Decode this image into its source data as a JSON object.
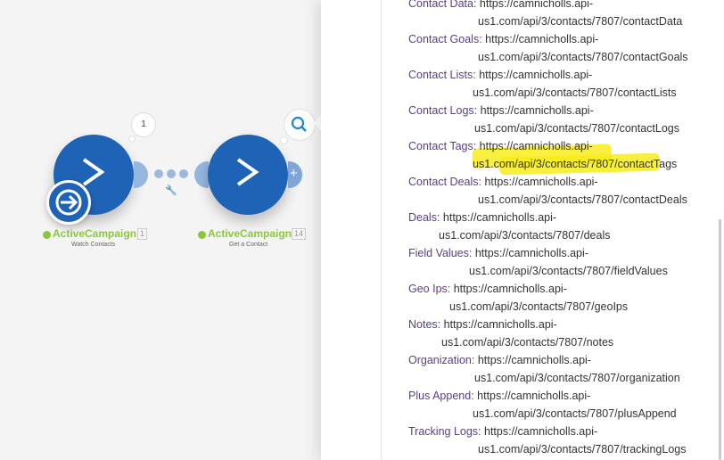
{
  "scenario": {
    "modules": [
      {
        "name": "ActiveCampaign",
        "subtitle": "Watch Contacts",
        "count": "1",
        "bubble": "1"
      },
      {
        "name": "ActiveCampaign",
        "subtitle": "Get a Contact",
        "count": "14"
      }
    ]
  },
  "panel": {
    "items": [
      {
        "key": "Contact Data:",
        "line1": "https://camnicholls.api-",
        "line2": "us1.com/api/3/contacts/7807/contactData"
      },
      {
        "key": "Contact Goals:",
        "line1": "https://camnicholls.api-",
        "line2": "us1.com/api/3/contacts/7807/contactGoals"
      },
      {
        "key": "Contact Lists:",
        "line1": "https://camnicholls.api-",
        "line2": "us1.com/api/3/contacts/7807/contactLists"
      },
      {
        "key": "Contact Logs:",
        "line1": "https://camnicholls.api-",
        "line2": "us1.com/api/3/contacts/7807/contactLogs"
      },
      {
        "key": "Contact Tags:",
        "line1": "https://camnicholls.api-",
        "line2": "us1.com/api/3/contacts/7807/contactTags"
      },
      {
        "key": "Contact Deals:",
        "line1": "https://camnicholls.api-",
        "line2": "us1.com/api/3/contacts/7807/contactDeals"
      },
      {
        "key": "Deals:",
        "line1": "https://camnicholls.api-",
        "line2": "us1.com/api/3/contacts/7807/deals"
      },
      {
        "key": "Field Values:",
        "line1": "https://camnicholls.api-",
        "line2": "us1.com/api/3/contacts/7807/fieldValues"
      },
      {
        "key": "Geo Ips:",
        "line1": "https://camnicholls.api-",
        "line2": "us1.com/api/3/contacts/7807/geoIps"
      },
      {
        "key": "Notes:",
        "line1": "https://camnicholls.api-",
        "line2": "us1.com/api/3/contacts/7807/notes"
      },
      {
        "key": "Organization:",
        "line1": "https://camnicholls.api-",
        "line2": "us1.com/api/3/contacts/7807/organization"
      },
      {
        "key": "Plus Append:",
        "line1": "https://camnicholls.api-",
        "line2": "us1.com/api/3/contacts/7807/plusAppend"
      },
      {
        "key": "Tracking Logs:",
        "line1": "https://camnicholls.api-",
        "line2": "us1.com/api/3/contacts/7807/trackingLogs"
      }
    ]
  },
  "colors": {
    "module": "#1e63b6",
    "key": "#5a3f86",
    "highlight": "#f7ec1c",
    "status": "#8cc63f"
  },
  "icons": [
    "activecampaign-chevron-icon",
    "trigger-arrow-icon",
    "search-icon",
    "wrench-icon",
    "add-icon",
    "check-icon"
  ]
}
